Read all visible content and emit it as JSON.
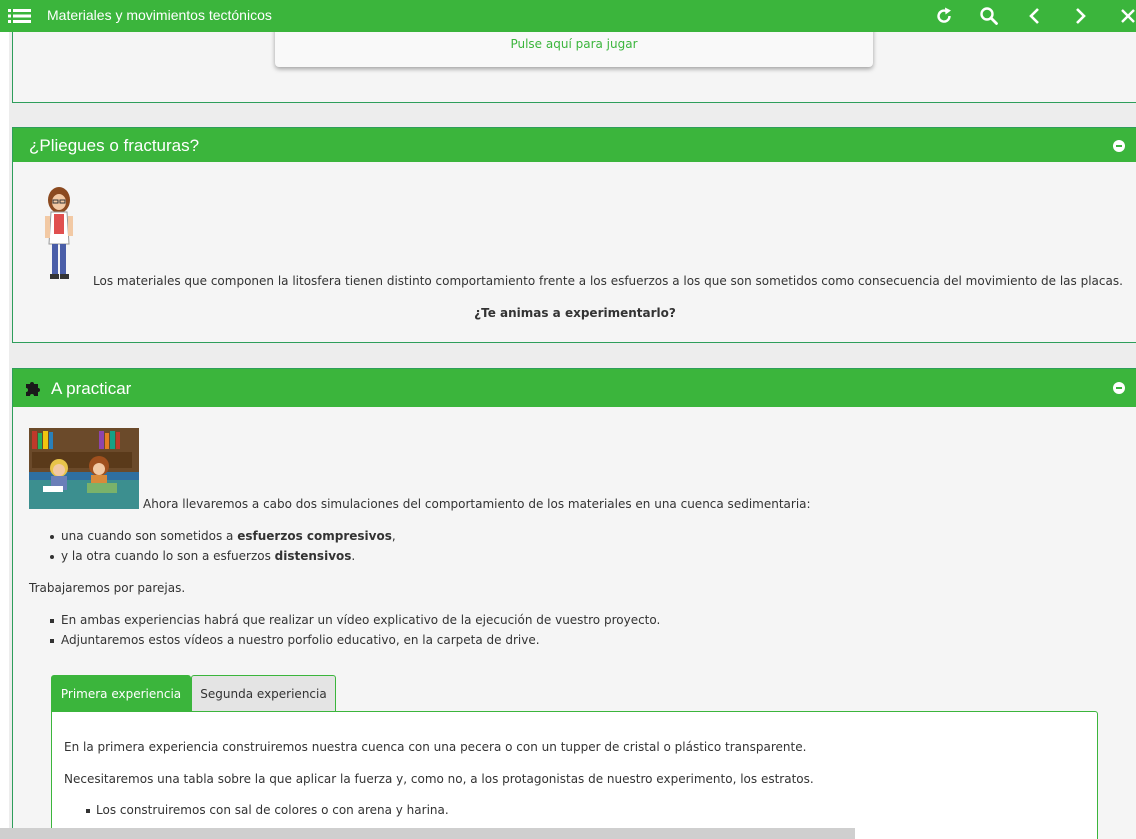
{
  "topbar": {
    "title": "Materiales y movimientos tectónicos",
    "icons": [
      "menu-list-icon",
      "refresh-icon",
      "search-icon",
      "chevron-left-icon",
      "chevron-right-icon",
      "close-icon"
    ],
    "background": "#3bb53c"
  },
  "game_panel": {
    "link_text": "Pulse aquí para jugar"
  },
  "pliegues": {
    "title": "¿Pliegues o fracturas?",
    "text": "Los materiales que componen la litosfera tienen distinto comportamiento frente a los esfuerzos a los que son sometidos como consecuencia del movimiento de las placas.",
    "question": "¿Te animas a experimentarlo?"
  },
  "practicar": {
    "title": "A practicar",
    "intro": "Ahora llevaremos a cabo dos simulaciones del comportamiento de los materiales en una cuenca sedimentaria:",
    "items": [
      {
        "pre": "una cuando son sometidos a ",
        "bold": "esfuerzos compresivos",
        "post": ","
      },
      {
        "pre": "y la otra cuando lo son a esfuerzos ",
        "bold": "distensivos",
        "post": "."
      }
    ],
    "pairs": "Trabajaremos por parejas.",
    "notes": [
      "En ambas experiencias habrá que realizar un vídeo explicativo de la ejecución de vuestro proyecto.",
      "Adjuntaremos estos vídeos a nuestro porfolio educativo, en la carpeta de drive."
    ],
    "tabs": [
      {
        "label": "Primera experiencia",
        "active": true
      },
      {
        "label": "Segunda experiencia",
        "active": false
      }
    ],
    "tab_content": {
      "p1": "En la primera experiencia construiremos nuestra cuenca con una pecera o con un tupper de cristal o plástico transparente.",
      "p2": "Necesitaremos una tabla sobre la que aplicar la fuerza y, como no, a los protagonistas de nuestro experimento, los estratos.",
      "bullet1": "Los construiremos con sal de colores o con arena y harina."
    }
  },
  "colors": {
    "accent": "#3bb53c",
    "panel_border": "#2e9e5b",
    "panel_bg": "#f5f5f5",
    "page_bg": "#ededed"
  }
}
